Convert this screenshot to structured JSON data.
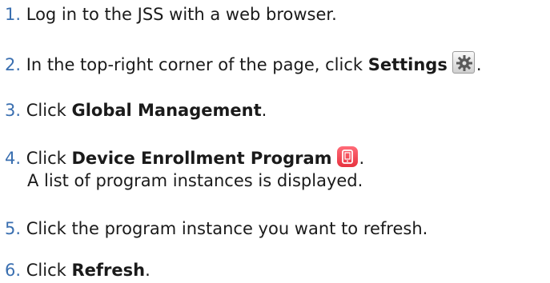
{
  "steps": [
    {
      "num": "1.",
      "text": "Log in to the JSS with a web browser."
    },
    {
      "num": "2.",
      "pre": "In the top-right corner of the page, click ",
      "bold": "Settings",
      "icon": "gear-icon",
      "post": "."
    },
    {
      "num": "3.",
      "pre": "Click ",
      "bold": "Global Management",
      "post": "."
    },
    {
      "num": "4.",
      "pre": "Click ",
      "bold": "Device Enrollment Program",
      "icon": "device-enrollment-icon",
      "post": ".",
      "sub": "A list of program instances is displayed."
    },
    {
      "num": "5.",
      "text": "Click the program instance you want to refresh."
    },
    {
      "num": "6.",
      "pre": "Click ",
      "bold": "Refresh",
      "post": "."
    }
  ],
  "colors": {
    "step_number": "#3a6fb0",
    "device_icon": "#e8323f"
  }
}
